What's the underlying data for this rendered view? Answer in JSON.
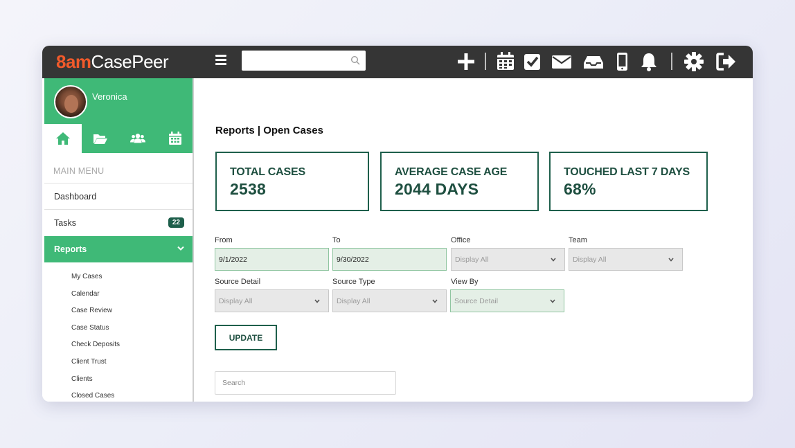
{
  "brand": {
    "part1": "8am",
    "part2": "CasePeer"
  },
  "topbar": {
    "search_value": "",
    "search_placeholder": "",
    "icons": [
      "plus-icon",
      "calendar-icon",
      "checkbox-icon",
      "mail-icon",
      "inbox-icon",
      "phone-icon",
      "bell-icon",
      "gear-icon",
      "logout-icon"
    ]
  },
  "profile": {
    "name": "Veronica"
  },
  "sidebar": {
    "tabs": [
      "home-icon",
      "folder-icon",
      "users-icon",
      "calendar-icon"
    ],
    "menu_heading": "MAIN MENU",
    "items": [
      {
        "label": "Dashboard"
      },
      {
        "label": "Tasks",
        "badge": "22"
      },
      {
        "label": "Reports"
      }
    ],
    "submenu": [
      "My Cases",
      "Calendar",
      "Case Review",
      "Case Status",
      "Check Deposits",
      "Client Trust",
      "Clients",
      "Closed Cases"
    ]
  },
  "page": {
    "title": "Reports | Open Cases"
  },
  "stats": [
    {
      "label": "TOTAL CASES",
      "value": "2538"
    },
    {
      "label": "AVERAGE CASE AGE",
      "value": "2044 DAYS"
    },
    {
      "label": "TOUCHED LAST 7 DAYS",
      "value": "68%"
    }
  ],
  "filters": {
    "from": {
      "label": "From",
      "value": "9/1/2022"
    },
    "to": {
      "label": "To",
      "value": "9/30/2022"
    },
    "office": {
      "label": "Office",
      "value": "Display All"
    },
    "team": {
      "label": "Team",
      "value": "Display All"
    },
    "source_detail": {
      "label": "Source Detail",
      "value": "Display All"
    },
    "source_type": {
      "label": "Source Type",
      "value": "Display All"
    },
    "view_by": {
      "label": "View By",
      "value": "Source Detail"
    }
  },
  "update_label": "UPDATE",
  "table_search": {
    "placeholder": "Search"
  },
  "colors": {
    "brand_orange": "#f15a2b",
    "accent_green": "#3fb977",
    "dark_green": "#1e5f4b",
    "topbar": "#353535"
  }
}
